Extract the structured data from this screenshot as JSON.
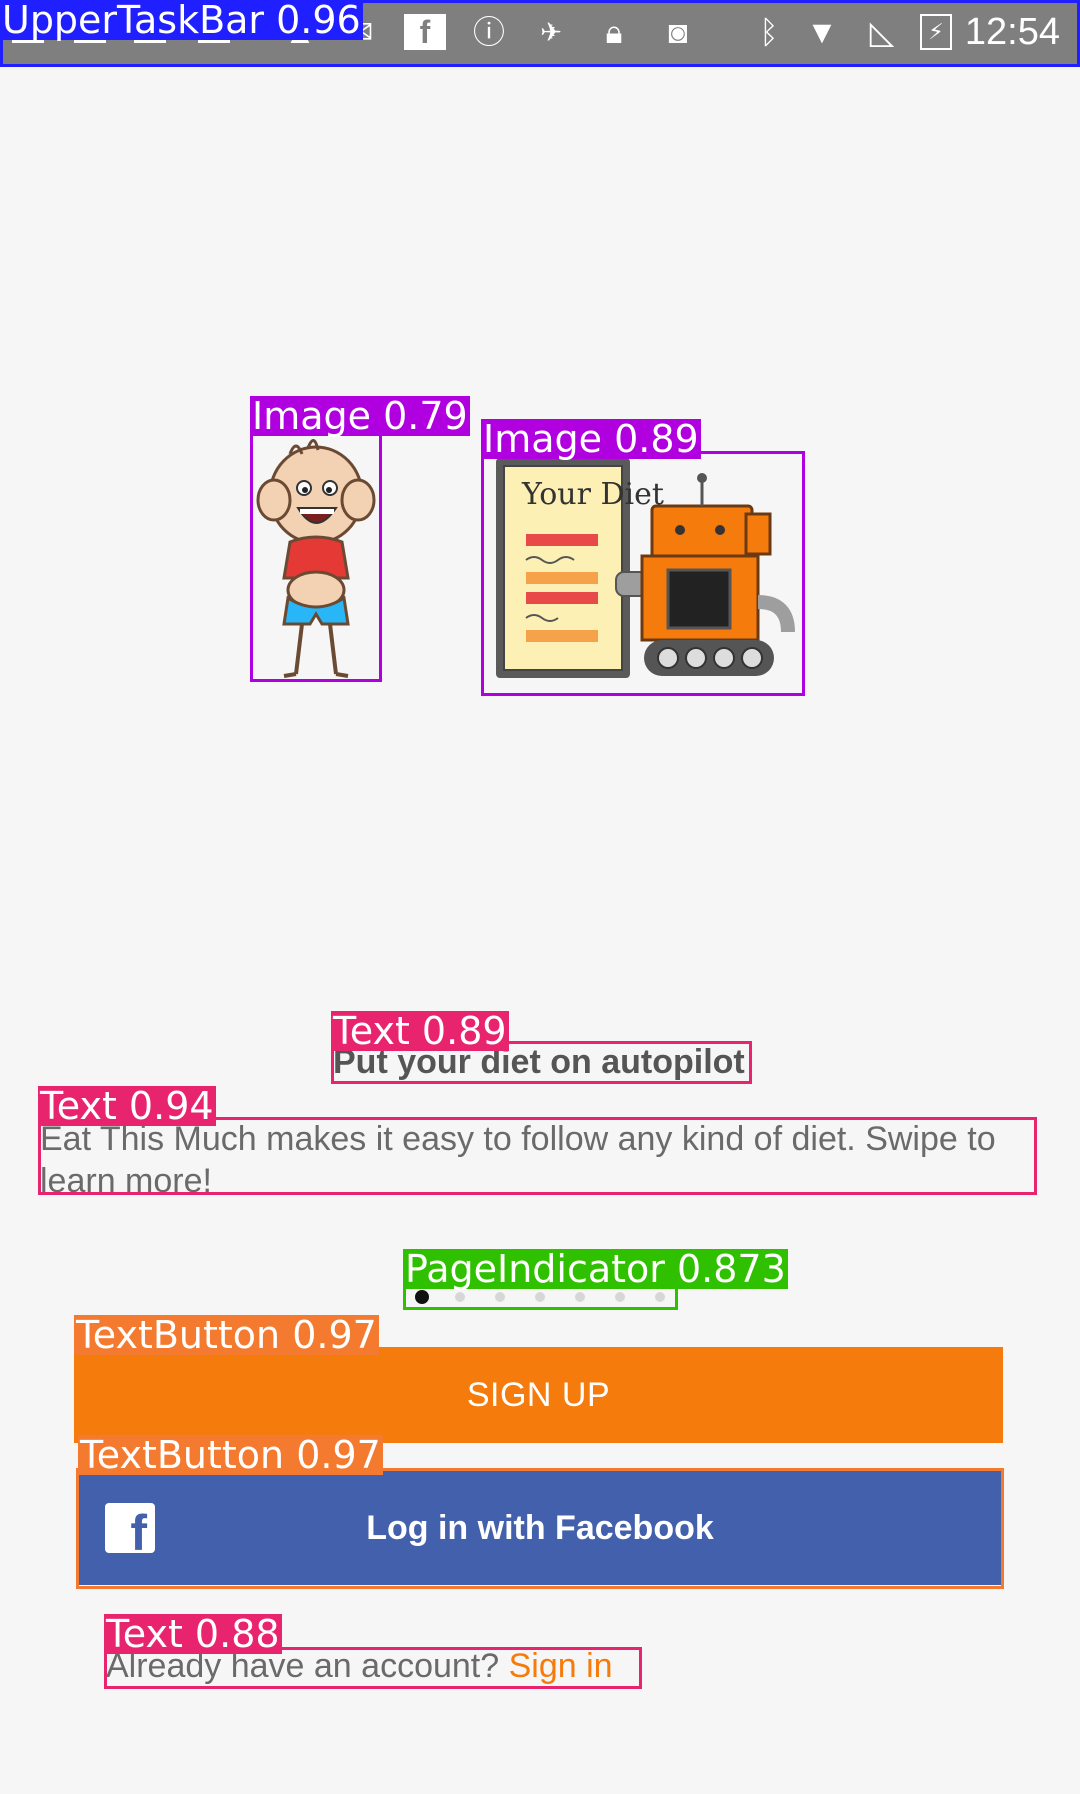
{
  "status_bar": {
    "time": "12:54",
    "icons": [
      "notification-icon",
      "notification-icon",
      "notification-icon",
      "notification-icon",
      "notification-icon",
      "notification-icon",
      "facebook-icon",
      "info-icon",
      "fake-gps-icon",
      "lock-icon",
      "android-icon",
      "bluetooth-icon",
      "wifi-icon",
      "no-signal-icon",
      "battery-charging-icon"
    ]
  },
  "illustration": {
    "image_text": "Your Diet"
  },
  "onboarding": {
    "headline": "Put your diet on autopilot",
    "description": "Eat This Much makes it easy to follow any kind of diet. Swipe to learn more!",
    "pages": 7,
    "active_page": 1
  },
  "buttons": {
    "signup_label": "SIGN UP",
    "facebook_label": "Log in with Facebook",
    "facebook_icon": "f"
  },
  "footer": {
    "prompt": "Already have an account? ",
    "signin_link": "Sign in"
  },
  "detections": {
    "status_bar": "UpperTaskBar 0.96",
    "image_kid": "Image 0.79",
    "image_robot": "Image 0.89",
    "headline": "Text 0.89",
    "description": "Text 0.94",
    "page_indicator": "PageIndicator 0.873",
    "signup": "TextButton 0.97",
    "facebook": "TextButton 0.97",
    "signin": "Text 0.88"
  },
  "colors": {
    "accent": "#f57c0c",
    "facebook_blue": "#4260ab",
    "box_blue": "#1f1fff",
    "box_purple": "#b000e0",
    "box_pink": "#e8246f",
    "box_green": "#2fc000",
    "box_orange": "#f47a30"
  }
}
